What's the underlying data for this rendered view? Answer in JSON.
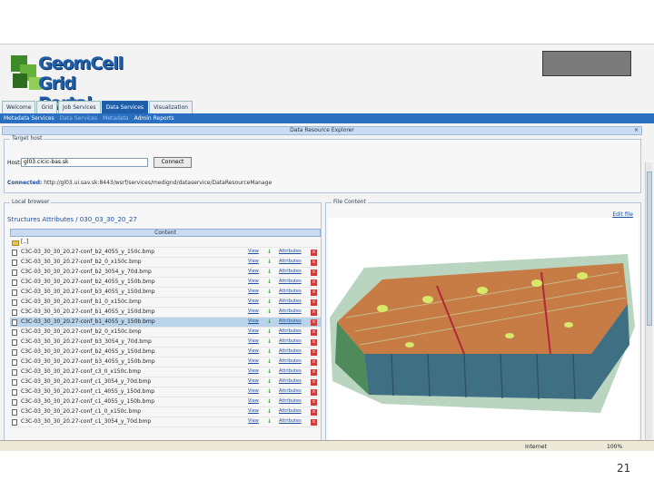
{
  "logo": {
    "line1": "GeomCell",
    "line2": "Grid Portal"
  },
  "tabs": [
    {
      "label": "Welcome"
    },
    {
      "label": "Grid"
    },
    {
      "label": "Job Services"
    },
    {
      "label": "Data Services"
    },
    {
      "label": "Visualization"
    }
  ],
  "subnav": [
    {
      "label": "Metadata Services"
    },
    {
      "label": "Data Services"
    },
    {
      "label": "Metadata"
    },
    {
      "label": "Admin Reports"
    }
  ],
  "panel_title": "Data Resource Explorer",
  "target": {
    "legend": "Target host",
    "host_label": "Host:",
    "host_value": "gl03.cicic-bas.sk",
    "connect_label": "Connect",
    "connected_label": "Connected:",
    "connected_url": "http://gl03.ui.sav.sk:8443/wsrf/services/medignd/dataservice/DataResourceManage"
  },
  "local": {
    "legend": "Local browser",
    "path": "Structures Attributes / 030_03_30_20_27",
    "content_header": "Content",
    "parent_dir": "[..]",
    "files": [
      "C3C-03_30_30_20.27-conf_b2_4055_y_150c.bmp",
      "C3C-03_30_30_20.27-conf_b2_0_x150c.bmp",
      "C3C-03_30_30_20.27-conf_b2_3054_y_70d.bmp",
      "C3C-03_30_30_20.27-conf_b2_4055_y_150b.bmp",
      "C3C-03_30_30_20.27-conf_b3_4055_y_150d.bmp",
      "C3C-03_30_30_20.27-conf_b1_0_x150c.bmp",
      "C3C-03_30_30_20.27-conf_b1_4055_y_150d.bmp",
      "C3C-03_30_30_20.27-conf_b1_4055_y_150b.bmp",
      "C3C-03_30_30_20.27-conf_b2_0_x150c.bmp",
      "C3C-03_30_30_20.27-conf_b3_3054_y_70d.bmp",
      "C3C-03_30_30_20.27-conf_b2_4055_y_150d.bmp",
      "C3C-03_30_30_20.27-conf_b3_4055_y_150b.bmp",
      "C3C-03_30_30_20.27-conf_c3_0_x150c.bmp",
      "C3C-03_30_30_20.27-conf_c1_3054_y_70d.bmp",
      "C3C-03_30_30_20.27-conf_c1_4055_y_150d.bmp",
      "C3C-03_30_30_20.27-conf_c1_4055_y_150b.bmp",
      "C3C-03_30_30_20.27-conf_c1_0_x150c.bmp",
      "C3C-03_30_30_20.27-conf_c1_3054_y_70d.bmp"
    ],
    "selected_index": 7,
    "view_label": "View",
    "attr_label": "Attributes"
  },
  "file": {
    "legend": "File Content",
    "edit_label": "Edit file"
  },
  "status": {
    "internet": "Internet",
    "zoom": "100%"
  },
  "slide_number": "21",
  "colors": {
    "accent": "#1f5faa",
    "selection": "#b9d3ea",
    "delete": "#d23b3b"
  }
}
